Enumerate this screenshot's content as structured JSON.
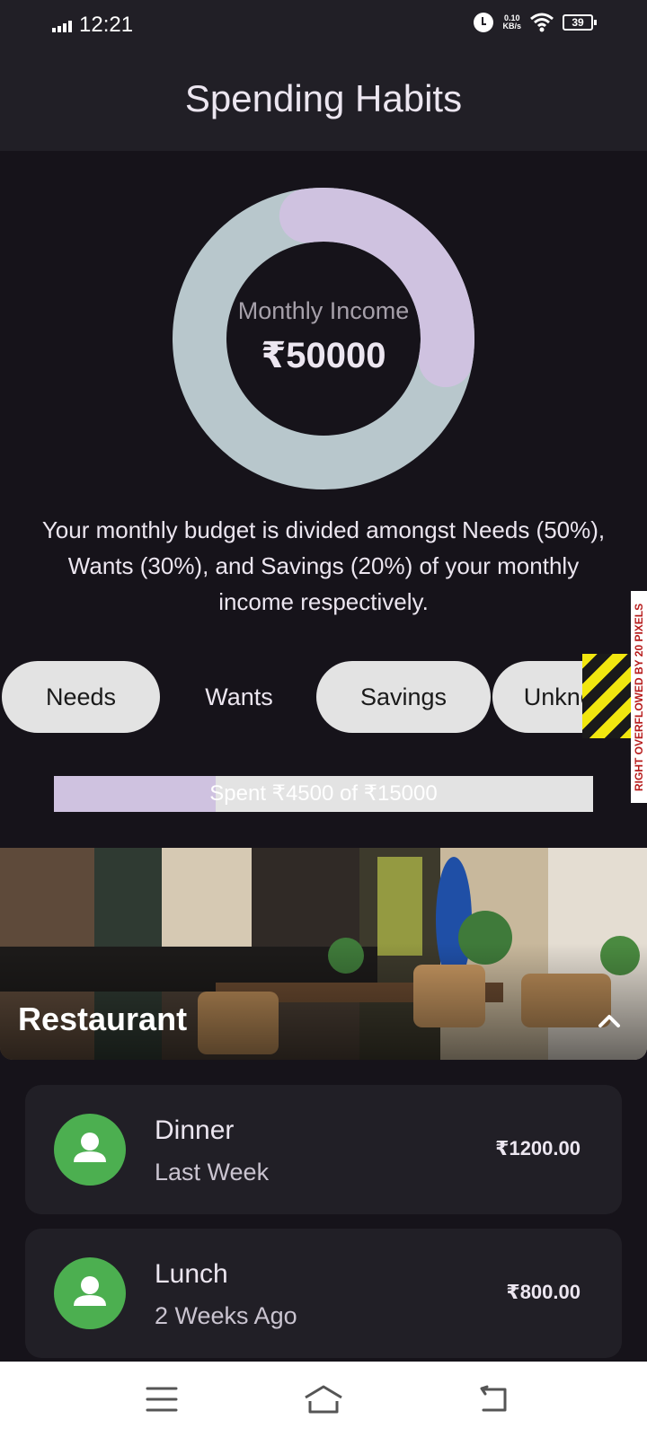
{
  "status_bar": {
    "time": "12:21",
    "net_speed_value": "0.10",
    "net_speed_unit": "KB/s",
    "battery": "39"
  },
  "app_bar": {
    "title": "Spending Habits"
  },
  "income_chart": {
    "label": "Monthly Income",
    "value": "₹50000",
    "ring_color": "#b8c7cc",
    "segment_color": "#cfc2e0"
  },
  "budget_description": "Your monthly budget is divided amongst Needs (50%), Wants (30%), and Savings (20%) of your monthly income respectively.",
  "chips": [
    {
      "label": "Needs",
      "selected": false
    },
    {
      "label": "Wants",
      "selected": true
    },
    {
      "label": "Savings",
      "selected": false
    },
    {
      "label": "Unknown",
      "selected": false
    }
  ],
  "overflow_warning": "RIGHT OVERFLOWED BY 20 PIXELS",
  "progress": {
    "label": "Spent ₹4500 of ₹15000",
    "spent": 4500,
    "total": 15000,
    "fill_color": "#cfc2e0"
  },
  "category": {
    "title": "Restaurant"
  },
  "transactions": [
    {
      "name": "Dinner",
      "time": "Last Week",
      "amount": "₹1200.00"
    },
    {
      "name": "Lunch",
      "time": "2 Weeks Ago",
      "amount": "₹800.00"
    }
  ],
  "colors": {
    "background": "#16131a",
    "surface": "#211f26",
    "chip": "#e3e3e3",
    "avatar": "#4caf50"
  }
}
